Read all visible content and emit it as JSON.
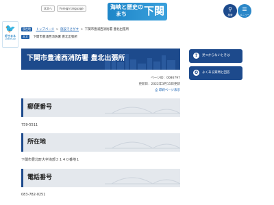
{
  "header": {
    "links": [
      "本文へ",
      "Foreign language"
    ],
    "logo": {
      "line1": "海峡と歴史の",
      "line2": "まち",
      "line3": "下関"
    },
    "search": {
      "icon": "search-icon",
      "caption": "検索"
    },
    "menu": {
      "icon": "menu-icon",
      "caption": "メニュー"
    }
  },
  "badge": {
    "icon": "bird-icon",
    "title": "好きまる",
    "subtitle": "Linkmup!"
  },
  "breadcrumb": {
    "tag1": "現在地",
    "items": [
      "トップページ",
      "施設でさがす",
      "下関市豊浦西消防署 豊北出張所"
    ],
    "tag2": "本文",
    "current": "下関市豊浦西消防署 豊北出張所"
  },
  "page": {
    "title": "下関市豊浦西消防署 豊北出張所",
    "page_id": "ページID：0086797",
    "updated": "更新日：2022年3月15日更新",
    "print_label": "印刷ページ表示"
  },
  "sections": [
    {
      "heading": "郵便番号",
      "value": "759-5511"
    },
    {
      "heading": "所在地",
      "value": "下関市豊北町大字滝部３１４０番地１"
    },
    {
      "heading": "電話番号",
      "value": "083-782-0251"
    }
  ],
  "sidebar": {
    "buttons": [
      {
        "icon": "magnifier-icon",
        "label": "見つからないときは"
      },
      {
        "icon": "question-icon",
        "label": "よくある質問と回答"
      }
    ]
  },
  "colors": {
    "navy": "#1d4a8c",
    "accent": "#2b87c8",
    "band": "#e4e8ed"
  }
}
